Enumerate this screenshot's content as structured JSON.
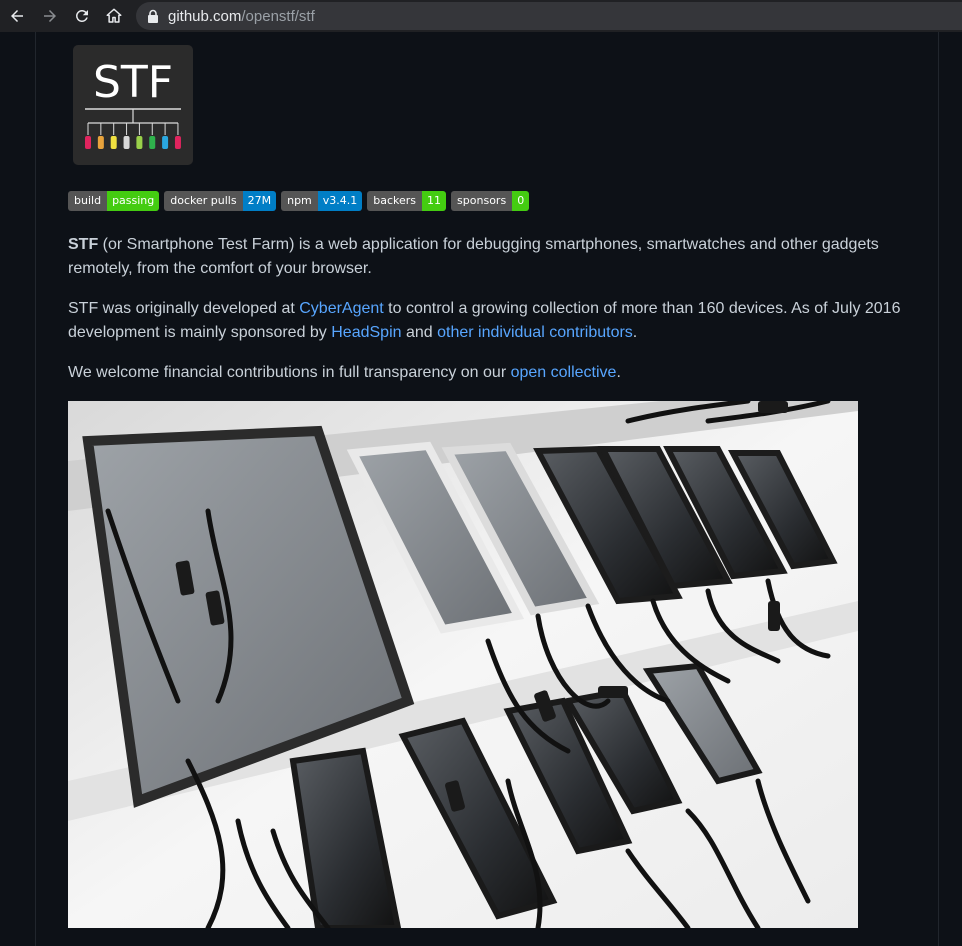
{
  "browser": {
    "url_host": "github.com",
    "url_path": "/openstf/stf"
  },
  "logo": {
    "text": "STF",
    "led_colors": [
      "#e0245e",
      "#e8a33c",
      "#f0e040",
      "#d8d8d8",
      "#9ad04a",
      "#2fb24c",
      "#2aa7e0",
      "#e0245e"
    ]
  },
  "badges": [
    {
      "label": "build",
      "value": "passing",
      "color": "#4c1"
    },
    {
      "label": "docker pulls",
      "value": "27M",
      "color": "#007ec6"
    },
    {
      "label": "npm",
      "value": "v3.4.1",
      "color": "#007ec6"
    },
    {
      "label": "backers",
      "value": "11",
      "color": "#4c1"
    },
    {
      "label": "sponsors",
      "value": "0",
      "color": "#4c1"
    }
  ],
  "intro": {
    "name": "STF",
    "text": " (or Smartphone Test Farm) is a web application for debugging smartphones, smartwatches and other gadgets remotely, from the comfort of your browser."
  },
  "history": {
    "t1": "STF was originally developed at ",
    "link1": "CyberAgent",
    "t2": " to control a growing collection of more than 160 devices. As of July 2016 development is mainly sponsored by ",
    "link2": "HeadSpin",
    "t3": " and ",
    "link3": "other individual contributors",
    "t4": "."
  },
  "funding": {
    "t1": "We welcome financial contributions in full transparency on our ",
    "link": "open collective",
    "t2": "."
  },
  "colors": {
    "link": "#58a6ff",
    "page_bg": "#0d1117",
    "text": "#c9d1d9"
  }
}
